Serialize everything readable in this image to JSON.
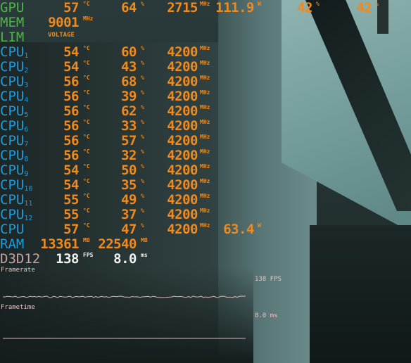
{
  "gpu": {
    "label": "GPU",
    "temp": "57",
    "temp_unit": "°C",
    "load": "64",
    "load_unit": "%",
    "clock": "2715",
    "clock_unit": "MHz",
    "power": "111.9",
    "power_unit": "W",
    "extra1": "42",
    "extra1_unit": "%",
    "extra2": "42",
    "extra2_unit": "%"
  },
  "mem": {
    "label": "MEM",
    "clock": "9001",
    "clock_unit": "MHz"
  },
  "lim": {
    "label": "LIM",
    "reason": "VOLTAGE"
  },
  "cpus": [
    {
      "label": "CPU",
      "sub": "1",
      "temp": "54",
      "load": "60",
      "clock": "4200"
    },
    {
      "label": "CPU",
      "sub": "2",
      "temp": "54",
      "load": "43",
      "clock": "4200"
    },
    {
      "label": "CPU",
      "sub": "3",
      "temp": "56",
      "load": "68",
      "clock": "4200"
    },
    {
      "label": "CPU",
      "sub": "4",
      "temp": "56",
      "load": "39",
      "clock": "4200"
    },
    {
      "label": "CPU",
      "sub": "5",
      "temp": "56",
      "load": "62",
      "clock": "4200"
    },
    {
      "label": "CPU",
      "sub": "6",
      "temp": "56",
      "load": "33",
      "clock": "4200"
    },
    {
      "label": "CPU",
      "sub": "7",
      "temp": "56",
      "load": "57",
      "clock": "4200"
    },
    {
      "label": "CPU",
      "sub": "8",
      "temp": "56",
      "load": "32",
      "clock": "4200"
    },
    {
      "label": "CPU",
      "sub": "9",
      "temp": "54",
      "load": "50",
      "clock": "4200"
    },
    {
      "label": "CPU",
      "sub": "10",
      "temp": "54",
      "load": "35",
      "clock": "4200"
    },
    {
      "label": "CPU",
      "sub": "11",
      "temp": "55",
      "load": "49",
      "clock": "4200"
    },
    {
      "label": "CPU",
      "sub": "12",
      "temp": "55",
      "load": "37",
      "clock": "4200"
    }
  ],
  "cpu_total": {
    "label": "CPU",
    "temp": "57",
    "load": "47",
    "clock": "4200",
    "power": "63.4",
    "power_unit": "W"
  },
  "units": {
    "temp": "°C",
    "load": "%",
    "clock": "MHz"
  },
  "ram": {
    "label": "RAM",
    "used": "13361",
    "used_unit": "MB",
    "total": "22540",
    "total_unit": "MB"
  },
  "d3d": {
    "label": "D3D12",
    "fps": "138",
    "fps_unit": "FPS",
    "frametime": "8.0",
    "frametime_unit": "ms"
  },
  "graphs": {
    "framerate_label": "Framerate",
    "framerate_value": "138 FPS",
    "frametime_label": "Frametime",
    "frametime_value": "8.0 ms"
  },
  "colors": {
    "gpu_label": "#4fb24b",
    "cpu_label": "#1e9bdb",
    "value": "#f08a1e",
    "d3d_label": "#c8a3a3",
    "fps_value": "#f2f2f2"
  }
}
